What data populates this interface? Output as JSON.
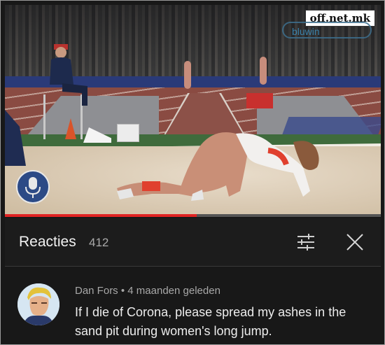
{
  "watermark": "off.net.mk",
  "video": {
    "channel_logo_text": "bluwin",
    "progress_fraction": 0.51
  },
  "panel": {
    "title": "Reacties",
    "count": "412"
  },
  "comment": {
    "author": "Dan Fors",
    "separator": "•",
    "time": "4 maanden geleden",
    "text": "If I die of Corona, please spread my ashes in the sand pit during women's long jump."
  },
  "icons": {
    "filter": "sliders-icon",
    "close": "close-icon"
  },
  "colors": {
    "background": "#181818",
    "progress": "#e02323",
    "text_primary": "#ededed",
    "text_secondary": "#a8a8a8"
  }
}
